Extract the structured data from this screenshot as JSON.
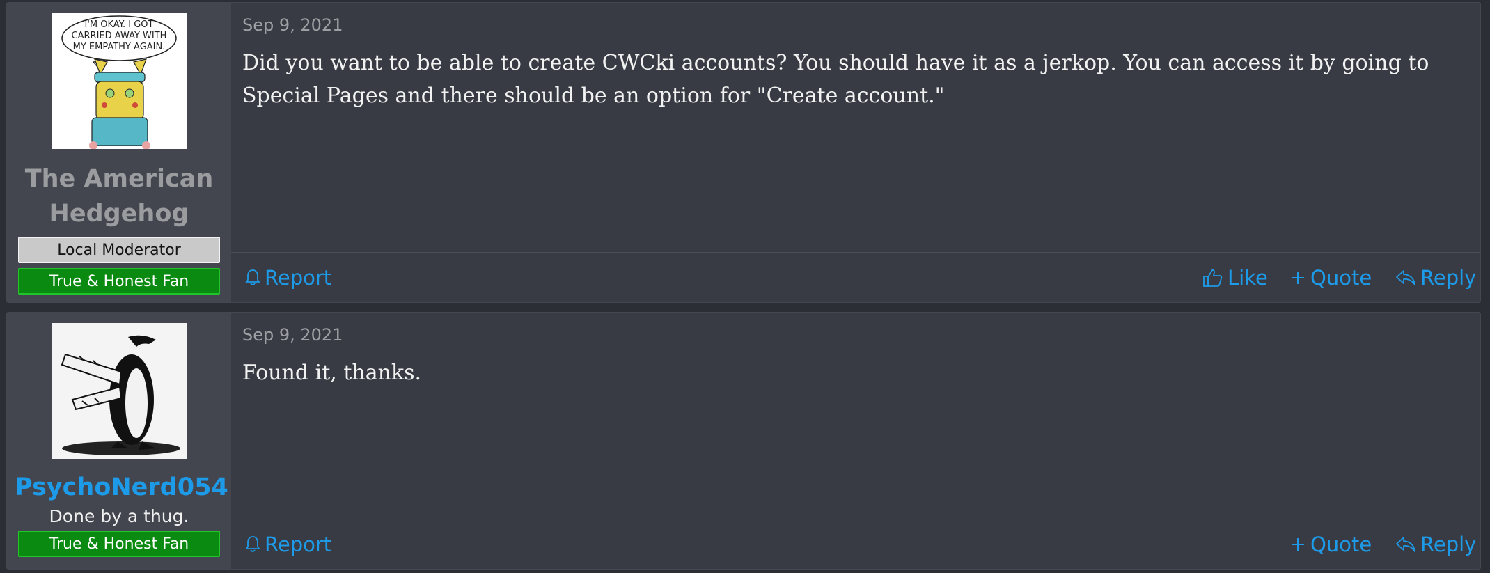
{
  "posts": [
    {
      "author": "The American Hedgehog",
      "role_banner": "Local Moderator",
      "user_banner": "True & Honest Fan",
      "avatar_caption": [
        "I'M OKAY. I GOT",
        "CARRIED AWAY WITH",
        "MY EMPATHY AGAIN."
      ],
      "date": "Sep 9, 2021",
      "body": "Did you want to be able to create CWCki accounts? You should have it as a jerkop. You can access it by going to Special Pages and there should be an option for \"Create account.\"",
      "actions": {
        "report": "Report",
        "like": "Like",
        "quote": "Quote",
        "reply": "Reply"
      }
    },
    {
      "author": "PsychoNerd054",
      "user_title": "Done by a thug.",
      "user_banner": "True & Honest Fan",
      "date": "Sep 9, 2021",
      "body": "Found it, thanks.",
      "actions": {
        "report": "Report",
        "quote": "Quote",
        "reply": "Reply"
      }
    }
  ],
  "colors": {
    "accent": "#1e9be8",
    "post_bg": "#383b43",
    "user_cell_bg": "#43464e",
    "fan_banner": "#0a8a10"
  },
  "icons": [
    "bell-icon",
    "thumbs-up-icon",
    "plus-icon",
    "reply-icon"
  ]
}
